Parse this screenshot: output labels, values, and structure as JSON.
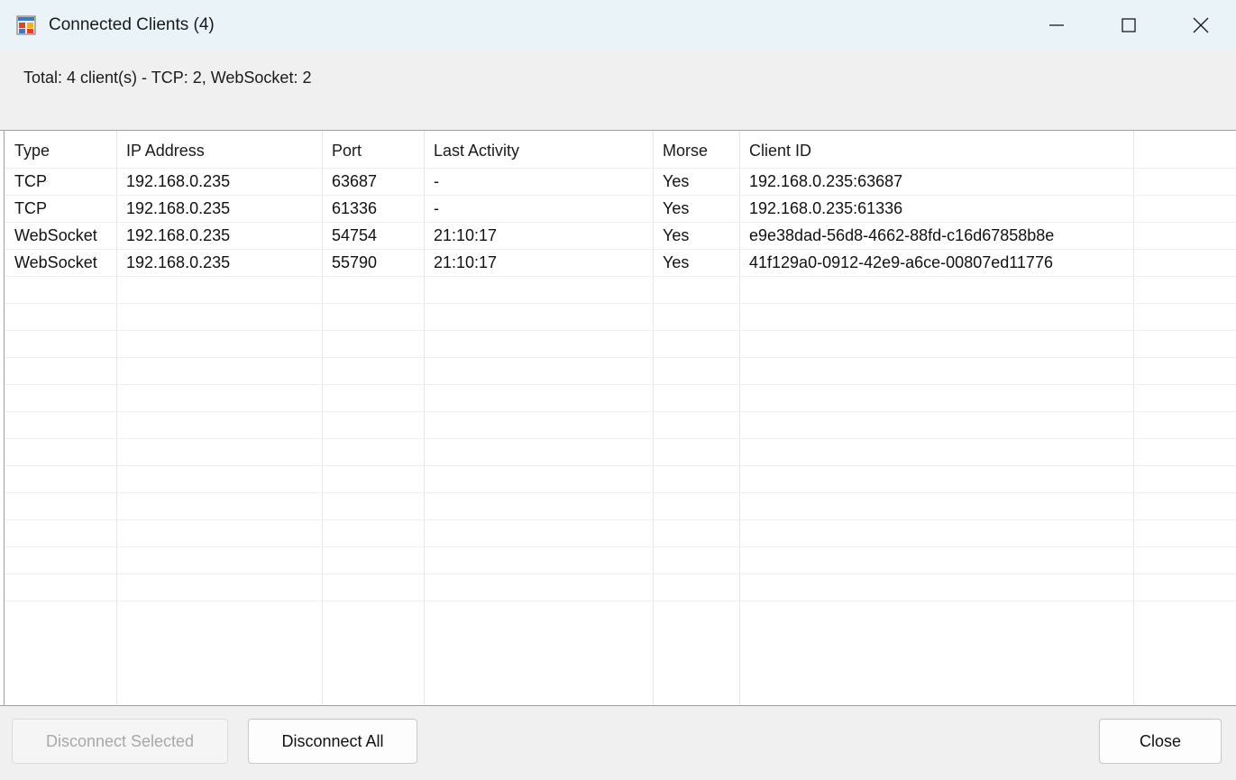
{
  "window": {
    "title": "Connected Clients (4)",
    "icon": "app-window-icon",
    "controls": [
      "minimize-icon",
      "maximize-icon",
      "close-icon"
    ]
  },
  "summary": {
    "text": "Total: 4 client(s) - TCP: 2, WebSocket: 2"
  },
  "table": {
    "columns": [
      "Type",
      "IP Address",
      "Port",
      "Last Activity",
      "Morse",
      "Client ID"
    ],
    "rows": [
      [
        "TCP",
        "192.168.0.235",
        "63687",
        "-",
        "Yes",
        "192.168.0.235:63687"
      ],
      [
        "TCP",
        "192.168.0.235",
        "61336",
        "-",
        "Yes",
        "192.168.0.235:61336"
      ],
      [
        "WebSocket",
        "192.168.0.235",
        "54754",
        "21:10:17",
        "Yes",
        "e9e38dad-56d8-4662-88fd-c16d67858b8e"
      ],
      [
        "WebSocket",
        "192.168.0.235",
        "55790",
        "21:10:17",
        "Yes",
        "41f129a0-0912-42e9-a6ce-00807ed11776"
      ]
    ]
  },
  "buttons": {
    "disconnect_selected": "Disconnect Selected",
    "disconnect_all": "Disconnect All",
    "close": "Close"
  },
  "colors": {
    "titlebar": "#eaf4f8",
    "panel": "#f0f0f0",
    "disabled_text": "#a8a8a8"
  }
}
